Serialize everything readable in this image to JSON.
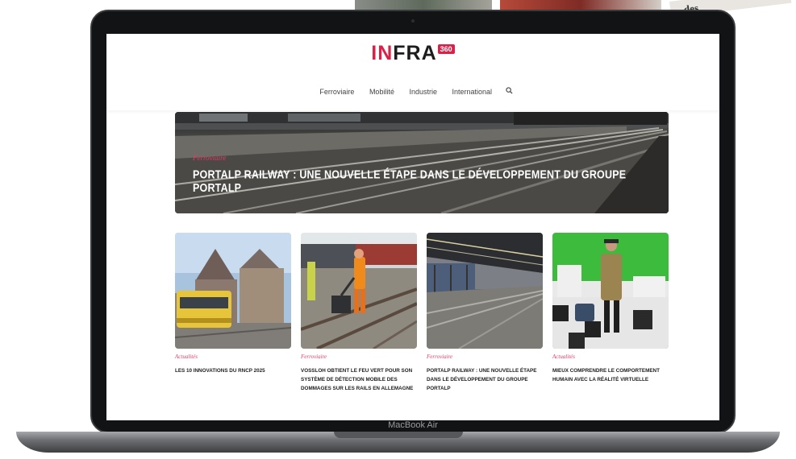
{
  "background": {
    "magazine_text": "des"
  },
  "laptop": {
    "model_label": "MacBook Air"
  },
  "site": {
    "logo": {
      "part_red": "IN",
      "part_dark": "FRA",
      "badge": "360"
    },
    "nav": [
      {
        "label": "Ferroviaire"
      },
      {
        "label": "Mobilité"
      },
      {
        "label": "Industrie"
      },
      {
        "label": "International"
      }
    ],
    "hero": {
      "category": "Ferroviaire",
      "title": "PORTALP RAILWAY : UNE NOUVELLE ÉTAPE DANS LE DÉVELOPPEMENT DU GROUPE PORTALP"
    },
    "cards": [
      {
        "category": "Actualités",
        "title": "LES 10 INNOVATIONS DU RNCP 2025",
        "image": "tram-city-photo"
      },
      {
        "category": "Ferroviaire",
        "title": "VOSSLOH OBTIENT LE FEU VERT POUR SON SYSTÈME DE DÉTECTION MOBILE DES DOMMAGES SUR LES RAILS EN ALLEMAGNE",
        "image": "rail-worker-photo"
      },
      {
        "category": "Ferroviaire",
        "title": "PORTALP RAILWAY : UNE NOUVELLE ÉTAPE DANS LE DÉVELOPPEMENT DU GROUPE PORTALP",
        "image": "platform-tracks-photo"
      },
      {
        "category": "Actualités",
        "title": "MIEUX COMPRENDRE LE COMPORTEMENT HUMAIN AVEC LA RÉALITÉ VIRTUELLE",
        "image": "green-screen-vr-photo"
      }
    ],
    "colors": {
      "accent": "#d9224a",
      "text": "#1d1d1f"
    }
  }
}
